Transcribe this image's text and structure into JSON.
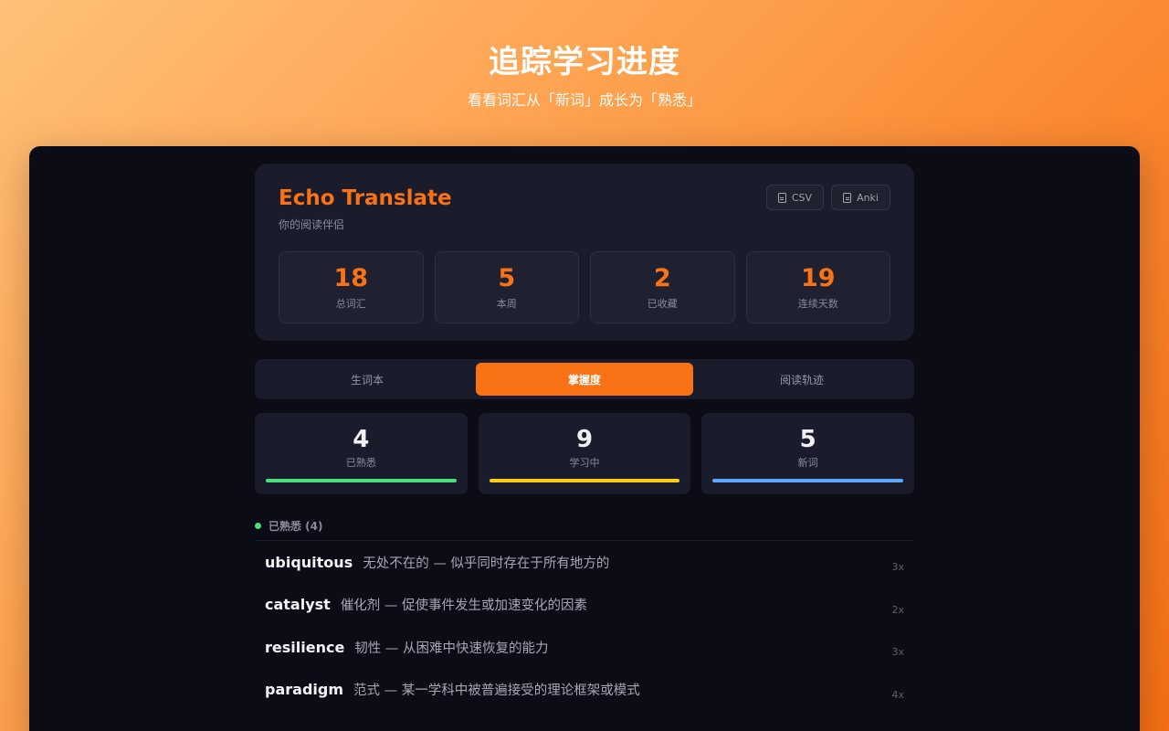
{
  "hero": {
    "title": "追踪学习进度",
    "subtitle": "看看词汇从「新词」成长为「熟悉」"
  },
  "app": {
    "brand": "Echo Translate",
    "tagline": "你的阅读伴侣",
    "exports": [
      {
        "label": "CSV",
        "icon": "file-icon"
      },
      {
        "label": "Anki",
        "icon": "file-icon"
      }
    ],
    "stats": [
      {
        "value": "18",
        "label": "总词汇"
      },
      {
        "value": "5",
        "label": "本周"
      },
      {
        "value": "2",
        "label": "已收藏"
      },
      {
        "value": "19",
        "label": "连续天数"
      }
    ],
    "tabs": [
      {
        "label": "生词本",
        "active": false
      },
      {
        "label": "掌握度",
        "active": true
      },
      {
        "label": "阅读轨迹",
        "active": false
      }
    ],
    "mastery": [
      {
        "value": "4",
        "label": "已熟悉",
        "color": "#4ade80"
      },
      {
        "value": "9",
        "label": "学习中",
        "color": "#facc15"
      },
      {
        "value": "5",
        "label": "新词",
        "color": "#60a5fa"
      }
    ],
    "section": {
      "label": "已熟悉 (4)",
      "dot_color": "#4ade80"
    },
    "words": [
      {
        "word": "ubiquitous",
        "definition": "无处不在的 — 似乎同时存在于所有地方的",
        "count": "3x"
      },
      {
        "word": "catalyst",
        "definition": "催化剂 — 促使事件发生或加速变化的因素",
        "count": "2x"
      },
      {
        "word": "resilience",
        "definition": "韧性 — 从困难中快速恢复的能力",
        "count": "3x"
      },
      {
        "word": "paradigm",
        "definition": "范式 — 某一学科中被普遍接受的理论框架或模式",
        "count": "4x"
      }
    ],
    "colors": {
      "accent": "#f97316",
      "background": "#0c0c16",
      "card": "#1a1b2b"
    }
  }
}
